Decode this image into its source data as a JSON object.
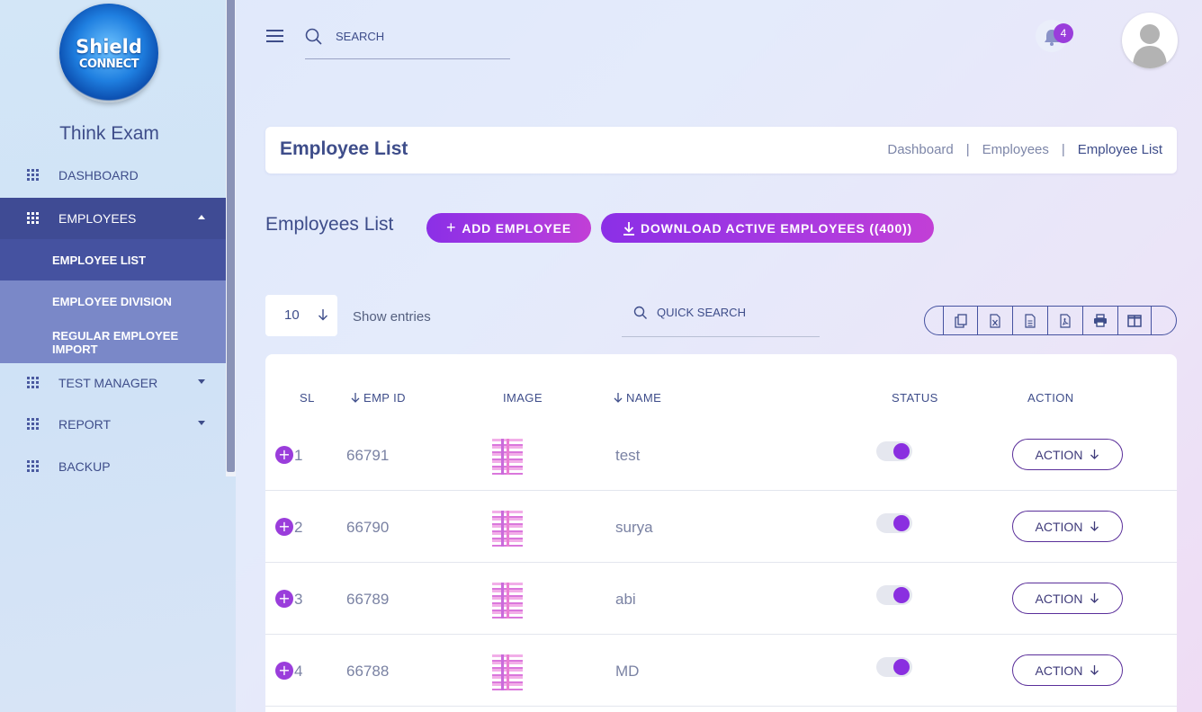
{
  "logo": {
    "line1": "Shield",
    "line2": "CONNECT"
  },
  "sidebar": {
    "brand": "Think Exam",
    "items": [
      {
        "label": "DASHBOARD",
        "icon": "grid-icon"
      },
      {
        "label": "EMPLOYEES",
        "icon": "grid-icon",
        "expanded": true
      },
      {
        "label": "TEST MANAGER",
        "icon": "grid-icon"
      },
      {
        "label": "REPORT",
        "icon": "grid-icon"
      },
      {
        "label": "BACKUP",
        "icon": "grid-icon"
      }
    ],
    "sub_items": [
      {
        "label": "EMPLOYEE LIST"
      },
      {
        "label": "EMPLOYEE DIVISION"
      },
      {
        "label": "REGULAR EMPLOYEE IMPORT"
      }
    ]
  },
  "header": {
    "search_placeholder": "SEARCH",
    "notifications_count": "4"
  },
  "page": {
    "title": "Employee List",
    "breadcrumb": [
      "Dashboard",
      "|",
      "Employees",
      "|",
      "Employee List"
    ],
    "section_title": "Employees List",
    "add_button": "ADD EMPLOYEE",
    "download_button": "DOWNLOAD ACTIVE EMPLOYEES ((400))"
  },
  "controls": {
    "entries_value": "10",
    "show_entries_label": "Show entries",
    "quick_search_placeholder": "QUICK SEARCH",
    "export_buttons": [
      "copy-icon",
      "excel-icon",
      "csv-icon",
      "pdf-icon",
      "print-icon",
      "columns-icon"
    ]
  },
  "table": {
    "headers": [
      "SL",
      "EMP ID",
      "IMAGE",
      "NAME",
      "STATUS",
      "ACTION"
    ],
    "rows": [
      {
        "sl": "1",
        "emp_id": "66791",
        "name": "test",
        "status": true,
        "action": "ACTION"
      },
      {
        "sl": "2",
        "emp_id": "66790",
        "name": "surya",
        "status": true,
        "action": "ACTION"
      },
      {
        "sl": "3",
        "emp_id": "66789",
        "name": "abi",
        "status": true,
        "action": "ACTION"
      },
      {
        "sl": "4",
        "emp_id": "66788",
        "name": "MD",
        "status": true,
        "action": "ACTION"
      }
    ]
  },
  "colors": {
    "primary": "#3f4b94",
    "accent": "#9a3ddb",
    "gradient_start": "#8b2fe6",
    "gradient_end": "#c23fd6"
  }
}
